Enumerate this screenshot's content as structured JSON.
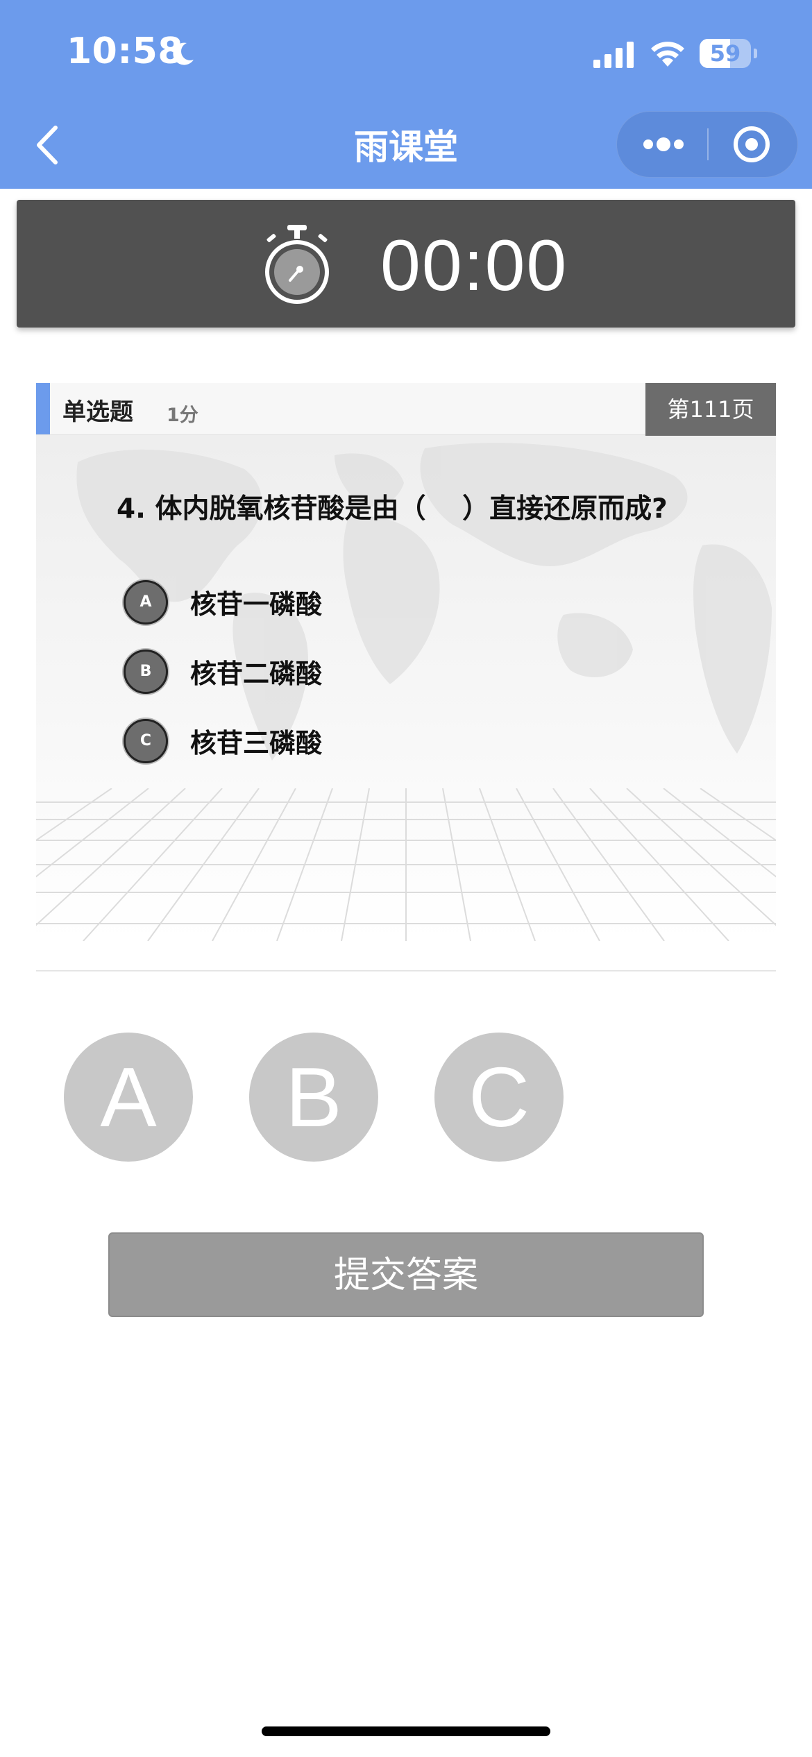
{
  "status_bar": {
    "time": "10:58",
    "battery": "59",
    "battery_level": 0.59
  },
  "nav": {
    "title": "雨课堂"
  },
  "timer": {
    "value": "00:00"
  },
  "slide": {
    "question_type": "单选题",
    "score": "1分",
    "page": "第111页",
    "question": "4. 体内脱氧核苷酸是由（　 ）直接还原而成?",
    "options": [
      {
        "letter": "A",
        "text": "核苷一磷酸"
      },
      {
        "letter": "B",
        "text": "核苷二磷酸"
      },
      {
        "letter": "C",
        "text": "核苷三磷酸"
      }
    ]
  },
  "answers": {
    "choices": [
      "A",
      "B",
      "C"
    ]
  },
  "submit": {
    "label": "提交答案"
  },
  "colors": {
    "header_blue": "#6c9bec",
    "timer_bg": "#515151",
    "choice_gray": "#c8c8c8",
    "submit_gray": "#9a9a9a"
  }
}
